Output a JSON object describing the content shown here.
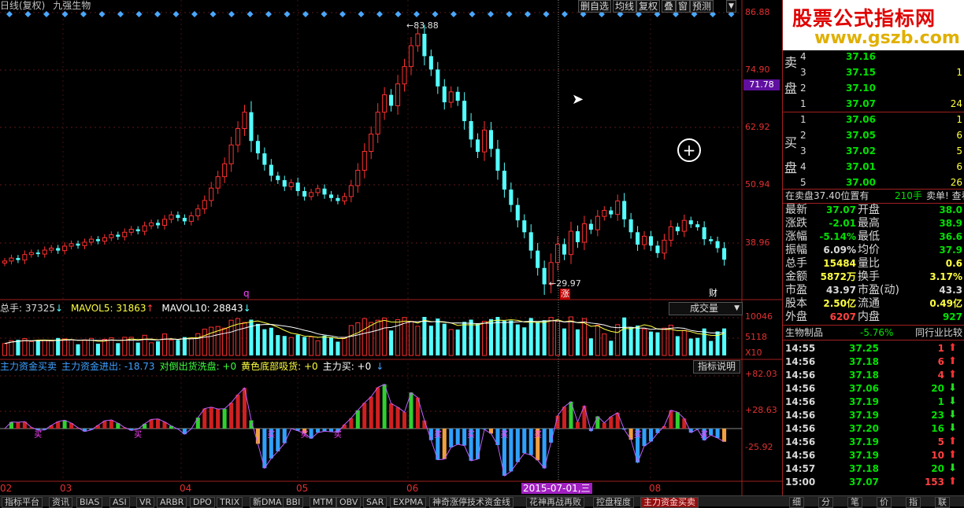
{
  "header": {
    "period": "日线(复权)",
    "stock_name": "九强生物",
    "buttons": [
      "删自选",
      "均线",
      "复权",
      "叠",
      "窗",
      "预测"
    ]
  },
  "price_axis": [
    "86.88",
    "74.90",
    "62.92",
    "50.94",
    "38.96"
  ],
  "current_price_tag": "71.78",
  "annotations": {
    "high": "83.88",
    "low": "29.97",
    "marker_q": "q",
    "marker_zhang": "涨",
    "marker_cai": "财"
  },
  "volume": {
    "label_total": "总手: 37325",
    "label_mavol5": "MAVOL5: 31863",
    "label_mavol10": "MAVOL10: 28843",
    "selector": "成交量",
    "axis": [
      "10046",
      "5118",
      "X10"
    ]
  },
  "indicator": {
    "labels": [
      {
        "text": "主力资金买卖",
        "color": "#40a0ff"
      },
      {
        "text": "主力资金进出: -18.73",
        "color": "#40a0ff"
      },
      {
        "text": "对倒出货洗盘: +0",
        "color": "#40ff40"
      },
      {
        "text": "黄色底部吸货: +0",
        "color": "#ffff40"
      },
      {
        "text": "主力买: +0",
        "color": "#ffffff"
      }
    ],
    "button": "指标说明",
    "axis": [
      "+82.03",
      "+28.63",
      "-25.92"
    ],
    "buy_label": "买"
  },
  "x_axis": [
    "02",
    "03",
    "04",
    "05",
    "06",
    "08"
  ],
  "date_marker": "2015-07-01,三",
  "logo": {
    "line1": "股票公式指标网",
    "line2": "www.gszb.com"
  },
  "order_book": {
    "sell_side_label": [
      "卖",
      "盘"
    ],
    "buy_side_label": [
      "买",
      "盘"
    ],
    "asks": [
      {
        "level": "4",
        "price": "37.16",
        "vol": ""
      },
      {
        "level": "3",
        "price": "37.15",
        "vol": "1"
      },
      {
        "level": "2",
        "price": "37.10",
        "vol": ""
      },
      {
        "level": "1",
        "price": "37.07",
        "vol": "24"
      }
    ],
    "bids": [
      {
        "level": "1",
        "price": "37.06",
        "vol": "1"
      },
      {
        "level": "2",
        "price": "37.05",
        "vol": "6"
      },
      {
        "level": "3",
        "price": "37.02",
        "vol": "5"
      },
      {
        "level": "4",
        "price": "37.01",
        "vol": "6"
      },
      {
        "level": "5",
        "price": "37.00",
        "vol": "26"
      }
    ]
  },
  "info_bar": {
    "left": "在卖盘37.40位置有",
    "mid": "210手",
    "right": "卖单! 查看详"
  },
  "quote": [
    {
      "l1": "最新",
      "v1": "37.07",
      "c1": "g",
      "l2": "开盘",
      "v2": "38.0",
      "c2": "g"
    },
    {
      "l1": "涨跌",
      "v1": "-2.01",
      "c1": "g",
      "l2": "最高",
      "v2": "38.9",
      "c2": "g"
    },
    {
      "l1": "涨幅",
      "v1": "-5.14%",
      "c1": "g",
      "l2": "最低",
      "v2": "36.6",
      "c2": "g"
    },
    {
      "l1": "振幅",
      "v1": "6.09%",
      "c1": "w",
      "l2": "均价",
      "v2": "37.9",
      "c2": "g"
    },
    {
      "l1": "总手",
      "v1": "15484",
      "c1": "y",
      "l2": "量比",
      "v2": "0.6",
      "c2": "y"
    },
    {
      "l1": "金额",
      "v1": "5872万",
      "c1": "y",
      "l2": "换手",
      "v2": "3.17%",
      "c2": "y"
    },
    {
      "l1": "市盈",
      "v1": "43.97",
      "c1": "w",
      "l2": "市盈(动)",
      "v2": "43.3",
      "c2": "w"
    },
    {
      "l1": "股本",
      "v1": "2.50亿",
      "c1": "y",
      "l2": "流通",
      "v2": "0.49亿",
      "c2": "y"
    },
    {
      "l1": "外盘",
      "v1": "6207",
      "c1": "r",
      "l2": "内盘",
      "v2": "927",
      "c2": "g"
    }
  ],
  "sector": {
    "name": "生物制品",
    "change": "-5.76%",
    "compare": "同行业比较"
  },
  "ticks": [
    {
      "time": "14:55",
      "price": "37.25",
      "vol": "1",
      "dir": "up"
    },
    {
      "time": "14:56",
      "price": "37.18",
      "vol": "6",
      "dir": "up"
    },
    {
      "time": "14:56",
      "price": "37.18",
      "vol": "4",
      "dir": "up"
    },
    {
      "time": "14:56",
      "price": "37.06",
      "vol": "20",
      "dir": "down"
    },
    {
      "time": "14:56",
      "price": "37.19",
      "vol": "1",
      "dir": "down"
    },
    {
      "time": "14:56",
      "price": "37.19",
      "vol": "23",
      "dir": "down"
    },
    {
      "time": "14:56",
      "price": "37.20",
      "vol": "16",
      "dir": "down"
    },
    {
      "time": "14:56",
      "price": "37.19",
      "vol": "5",
      "dir": "up"
    },
    {
      "time": "14:56",
      "price": "37.19",
      "vol": "10",
      "dir": "up"
    },
    {
      "time": "14:57",
      "price": "37.18",
      "vol": "20",
      "dir": "down"
    },
    {
      "time": "15:00",
      "price": "37.07",
      "vol": "153",
      "dir": "up"
    }
  ],
  "bottom_tabs": [
    "指标平台",
    "资讯",
    "BIAS",
    "ASI",
    "VR",
    "ARBR",
    "DPO",
    "TRIX",
    "新DMA",
    "BBI",
    "MTM",
    "OBV",
    "SAR",
    "EXPMA",
    "神奇涨停技术资金线",
    "花神再战再败",
    "控盘程度",
    "主力资金买卖"
  ],
  "bottom_tabs_active": "主力资金买卖",
  "bottom_right_tabs": [
    "细",
    "分",
    "笔",
    "价",
    "指",
    "联"
  ],
  "colors": {
    "up": "#ff3030",
    "down": "#54ffff",
    "frame": "#a02020",
    "axis_text": "#e03030",
    "tag": "#6010a0",
    "date_marker": "#a020c0"
  },
  "chart_data": {
    "type": "candlestick",
    "y_range": [
      29.97,
      86.88
    ],
    "high_label": 83.88,
    "low_label": 29.97,
    "close": [
      36.8,
      37.4,
      37.0,
      38.1,
      38.5,
      38.2,
      39.0,
      39.4,
      38.9,
      39.8,
      40.3,
      39.9,
      40.6,
      41.2,
      40.8,
      41.5,
      42.1,
      41.7,
      42.6,
      43.2,
      42.8,
      43.9,
      44.5,
      44.0,
      45.2,
      46.1,
      45.5,
      44.8,
      45.9,
      47.3,
      49.0,
      51.5,
      53.8,
      56.4,
      60.2,
      63.5,
      66.8,
      61.0,
      58.5,
      56.2,
      54.0,
      53.1,
      51.8,
      52.6,
      50.9,
      49.8,
      50.6,
      51.4,
      50.2,
      49.5,
      48.9,
      49.8,
      52.0,
      55.1,
      58.9,
      62.4,
      66.8,
      70.3,
      68.1,
      72.5,
      76.0,
      80.2,
      82.6,
      78.1,
      75.4,
      72.0,
      68.8,
      70.9,
      69.1,
      65.0,
      61.3,
      58.8,
      63.2,
      59.4,
      55.0,
      51.2,
      48.1,
      45.0,
      42.6,
      38.9,
      35.4,
      32.1,
      36.5,
      40.2,
      38.1,
      42.8,
      40.6,
      44.3,
      43.1,
      45.8,
      47.0,
      46.2,
      48.9,
      45.2,
      42.6,
      40.1,
      41.8,
      39.9,
      38.4,
      41.0,
      43.7,
      42.8,
      45.0,
      44.2,
      43.6,
      41.2,
      40.8,
      39.4,
      37.07
    ]
  }
}
